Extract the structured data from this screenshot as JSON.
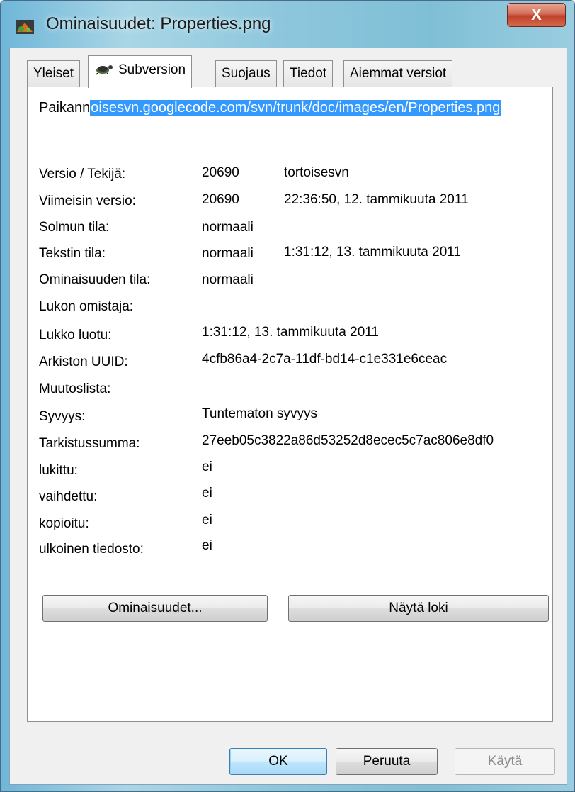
{
  "window": {
    "title": "Ominaisuudet: Properties.png",
    "close_label": "X"
  },
  "tabs": [
    {
      "label": "Yleiset",
      "active": false
    },
    {
      "label": "Subversion",
      "active": true
    },
    {
      "label": "Suojaus",
      "active": false
    },
    {
      "label": "Tiedot",
      "active": false
    },
    {
      "label": "Aiemmat versiot",
      "active": false
    }
  ],
  "url": {
    "prefix": "Paikann",
    "selected": "oisesvn.googlecode.com/svn/trunk/doc/images/en/Properties.png"
  },
  "fields": [
    {
      "label": "Versio / Tekijä:",
      "value": "20690",
      "extra": "tortoisesvn"
    },
    {
      "label": "Viimeisin versio:",
      "value": "20690",
      "extra": "22:36:50, 12. tammikuuta 2011"
    },
    {
      "label": "Solmun tila:",
      "value": "normaali",
      "extra": ""
    },
    {
      "label": "Tekstin tila:",
      "value": "normaali",
      "extra": "1:31:12, 13. tammikuuta 2011"
    },
    {
      "label": "Ominaisuuden tila:",
      "value": "normaali",
      "extra": ""
    },
    {
      "label": "Lukon omistaja:",
      "value": "",
      "extra": ""
    },
    {
      "label": "Lukko luotu:",
      "value": "1:31:12, 13. tammikuuta 2011",
      "extra": ""
    },
    {
      "label": "Arkiston UUID:",
      "value": "4cfb86a4-2c7a-11df-bd14-c1e331e6ceac",
      "extra": ""
    },
    {
      "label": "Muutoslista:",
      "value": "",
      "extra": ""
    },
    {
      "label": "Syvyys:",
      "value": "Tuntematon syvyys",
      "extra": ""
    },
    {
      "label": "Tarkistussumma:",
      "value": "27eeb05c3822a86d53252d8ecec5c7ac806e8df0",
      "extra": ""
    },
    {
      "label": "lukittu:",
      "value": "ei",
      "extra": ""
    },
    {
      "label": "vaihdettu:",
      "value": "ei",
      "extra": ""
    },
    {
      "label": "kopioitu:",
      "value": "ei",
      "extra": ""
    },
    {
      "label": "ulkoinen tiedosto:",
      "value": "ei",
      "extra": ""
    }
  ],
  "panel_buttons": {
    "properties": "Ominaisuudet...",
    "show_log": "Näytä loki"
  },
  "dialog_buttons": {
    "ok": "OK",
    "cancel": "Peruuta",
    "apply": "Käytä"
  }
}
